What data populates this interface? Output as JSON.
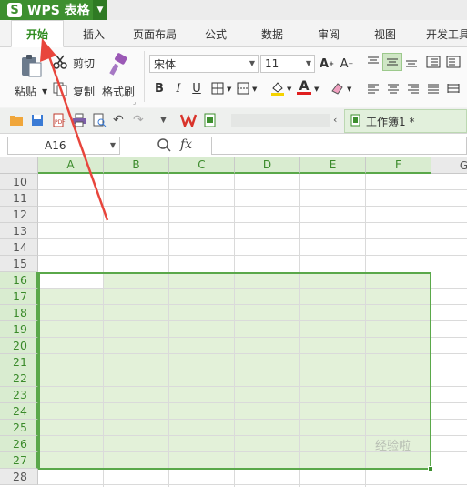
{
  "app": {
    "title": "WPS 表格",
    "logo": "S"
  },
  "tabs": [
    {
      "label": "开始",
      "active": true
    },
    {
      "label": "插入"
    },
    {
      "label": "页面布局"
    },
    {
      "label": "公式"
    },
    {
      "label": "数据"
    },
    {
      "label": "审阅"
    },
    {
      "label": "视图"
    },
    {
      "label": "开发工具"
    }
  ],
  "ribbon": {
    "paste_label": "粘贴",
    "cut_label": "剪切",
    "copy_label": "复制",
    "format_painter_label": "格式刷",
    "font_name": "宋体",
    "font_size": "11",
    "bold": "B",
    "italic": "I",
    "underline": "U"
  },
  "document_tab": {
    "label": "工作簿1 *"
  },
  "formula_bar": {
    "cell_ref": "A16",
    "fx_label": "fx",
    "value": ""
  },
  "sheet": {
    "columns": [
      "A",
      "B",
      "C",
      "D",
      "E",
      "F",
      "G"
    ],
    "rows": [
      "10",
      "11",
      "12",
      "13",
      "14",
      "15",
      "16",
      "17",
      "18",
      "19",
      "20",
      "21",
      "22",
      "23",
      "24",
      "25",
      "26",
      "27",
      "28"
    ],
    "selected_range": "A16:F27",
    "active_cell": "A16"
  },
  "watermark": "经验啦",
  "colors": {
    "accent": "#3d8f2f",
    "selection_fill": "#e3f1d9",
    "selection_border": "#5aa84a",
    "arrow": "#e8453c"
  }
}
